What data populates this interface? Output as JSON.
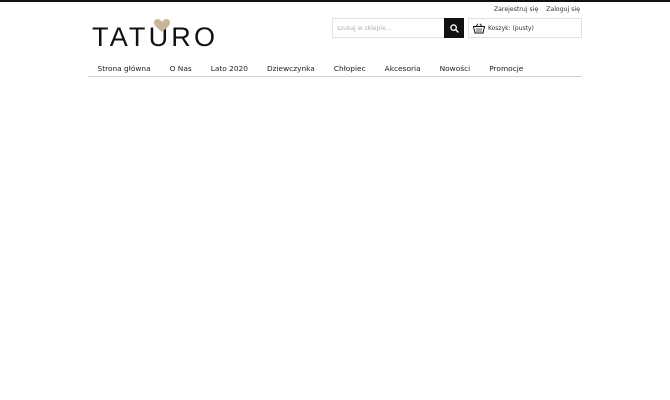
{
  "header": {
    "logo_text": "TATURO",
    "user_links": [
      "Zarejestruj się",
      "Zaloguj się"
    ],
    "search": {
      "placeholder": "szukaj w sklepie..."
    },
    "cart": {
      "label": "Koszyk: (pusty)"
    }
  },
  "nav": {
    "items": [
      "Strona główna",
      "O Nas",
      "Lato 2020",
      "Dziewczynka",
      "Chłopiec",
      "Akcesoria",
      "Nowości",
      "Promocje"
    ]
  },
  "colors": {
    "logo_heart": "#c8b69b",
    "dark": "#111111",
    "border": "#e1e1e1"
  },
  "icons": {
    "search_button": "search-icon",
    "cart": "basket-icon"
  }
}
